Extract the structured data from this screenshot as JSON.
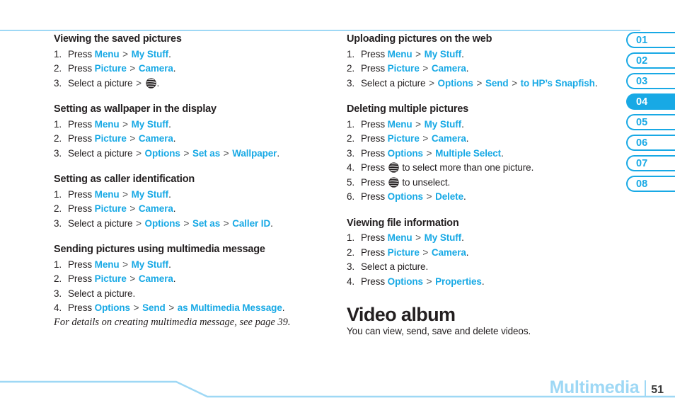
{
  "document": {
    "chapter_label": "Multimedia",
    "page_number": "51"
  },
  "icons": {
    "att_globe": "att-globe-icon"
  },
  "colors": {
    "keyword_blue": "#18a9e5",
    "rule_light_blue": "#9ed8f5",
    "body_text": "#231f20",
    "tab_active_bg": "#18a9e5",
    "tab_active_text": "#ffffff"
  },
  "tabs": [
    {
      "label": "01",
      "active": false
    },
    {
      "label": "02",
      "active": false
    },
    {
      "label": "03",
      "active": false
    },
    {
      "label": "04",
      "active": true
    },
    {
      "label": "05",
      "active": false
    },
    {
      "label": "06",
      "active": false
    },
    {
      "label": "07",
      "active": false
    },
    {
      "label": "08",
      "active": false
    }
  ],
  "left_column": {
    "sections": [
      {
        "title": "Viewing the saved pictures",
        "steps": [
          {
            "num": "1.",
            "parts": [
              {
                "t": "text",
                "v": "Press "
              },
              {
                "t": "kw",
                "v": "Menu"
              },
              {
                "t": "sep",
                "v": " > "
              },
              {
                "t": "kw",
                "v": "My Stuff"
              },
              {
                "t": "text",
                "v": "."
              }
            ]
          },
          {
            "num": "2.",
            "parts": [
              {
                "t": "text",
                "v": "Press "
              },
              {
                "t": "kw",
                "v": "Picture"
              },
              {
                "t": "sep",
                "v": " > "
              },
              {
                "t": "kw",
                "v": "Camera"
              },
              {
                "t": "text",
                "v": "."
              }
            ]
          },
          {
            "num": "3.",
            "parts": [
              {
                "t": "text",
                "v": "Select a picture "
              },
              {
                "t": "sep",
                "v": "> "
              },
              {
                "t": "icon",
                "v": "att-globe"
              },
              {
                "t": "text",
                "v": "."
              }
            ]
          }
        ]
      },
      {
        "title": "Setting as wallpaper in the display",
        "steps": [
          {
            "num": "1.",
            "parts": [
              {
                "t": "text",
                "v": "Press "
              },
              {
                "t": "kw",
                "v": "Menu"
              },
              {
                "t": "sep",
                "v": " > "
              },
              {
                "t": "kw",
                "v": "My Stuff"
              },
              {
                "t": "text",
                "v": "."
              }
            ]
          },
          {
            "num": "2.",
            "parts": [
              {
                "t": "text",
                "v": "Press "
              },
              {
                "t": "kw",
                "v": "Picture"
              },
              {
                "t": "sep",
                "v": " > "
              },
              {
                "t": "kw",
                "v": "Camera"
              },
              {
                "t": "text",
                "v": "."
              }
            ]
          },
          {
            "num": "3.",
            "parts": [
              {
                "t": "text",
                "v": "Select a picture "
              },
              {
                "t": "sep",
                "v": "> "
              },
              {
                "t": "kw",
                "v": "Options"
              },
              {
                "t": "sep",
                "v": " > "
              },
              {
                "t": "kw",
                "v": "Set as"
              },
              {
                "t": "sep",
                "v": " > "
              },
              {
                "t": "kw",
                "v": "Wallpaper"
              },
              {
                "t": "text",
                "v": "."
              }
            ]
          }
        ]
      },
      {
        "title": "Setting as caller identification",
        "steps": [
          {
            "num": "1.",
            "parts": [
              {
                "t": "text",
                "v": "Press "
              },
              {
                "t": "kw",
                "v": "Menu"
              },
              {
                "t": "sep",
                "v": " > "
              },
              {
                "t": "kw",
                "v": "My Stuff"
              },
              {
                "t": "text",
                "v": "."
              }
            ]
          },
          {
            "num": "2.",
            "parts": [
              {
                "t": "text",
                "v": "Press "
              },
              {
                "t": "kw",
                "v": "Picture"
              },
              {
                "t": "sep",
                "v": " > "
              },
              {
                "t": "kw",
                "v": "Camera"
              },
              {
                "t": "text",
                "v": "."
              }
            ]
          },
          {
            "num": "3.",
            "parts": [
              {
                "t": "text",
                "v": "Select a picture "
              },
              {
                "t": "sep",
                "v": "> "
              },
              {
                "t": "kw",
                "v": "Options"
              },
              {
                "t": "sep",
                "v": " > "
              },
              {
                "t": "kw",
                "v": "Set as"
              },
              {
                "t": "sep",
                "v": " > "
              },
              {
                "t": "kw",
                "v": "Caller ID"
              },
              {
                "t": "text",
                "v": "."
              }
            ]
          }
        ]
      },
      {
        "title": "Sending pictures using multimedia message",
        "steps": [
          {
            "num": "1.",
            "parts": [
              {
                "t": "text",
                "v": "Press "
              },
              {
                "t": "kw",
                "v": "Menu"
              },
              {
                "t": "sep",
                "v": " > "
              },
              {
                "t": "kw",
                "v": "My Stuff"
              },
              {
                "t": "text",
                "v": "."
              }
            ]
          },
          {
            "num": "2.",
            "parts": [
              {
                "t": "text",
                "v": "Press "
              },
              {
                "t": "kw",
                "v": "Picture"
              },
              {
                "t": "sep",
                "v": " > "
              },
              {
                "t": "kw",
                "v": "Camera"
              },
              {
                "t": "text",
                "v": "."
              }
            ]
          },
          {
            "num": "3.",
            "parts": [
              {
                "t": "text",
                "v": "Select a picture."
              }
            ]
          },
          {
            "num": "4.",
            "parts": [
              {
                "t": "text",
                "v": "Press "
              },
              {
                "t": "kw",
                "v": "Options"
              },
              {
                "t": "sep",
                "v": " > "
              },
              {
                "t": "kw",
                "v": "Send"
              },
              {
                "t": "sep",
                "v": " > "
              },
              {
                "t": "kw",
                "v": "as Multimedia Message"
              },
              {
                "t": "text",
                "v": "."
              }
            ]
          }
        ],
        "note": "For details on creating multimedia message, see page 39."
      }
    ]
  },
  "right_column": {
    "sections": [
      {
        "title": "Uploading pictures on the web",
        "steps": [
          {
            "num": "1.",
            "parts": [
              {
                "t": "text",
                "v": "Press "
              },
              {
                "t": "kw",
                "v": "Menu"
              },
              {
                "t": "sep",
                "v": " > "
              },
              {
                "t": "kw",
                "v": "My Stuff"
              },
              {
                "t": "text",
                "v": "."
              }
            ]
          },
          {
            "num": "2.",
            "parts": [
              {
                "t": "text",
                "v": "Press "
              },
              {
                "t": "kw",
                "v": "Picture"
              },
              {
                "t": "sep",
                "v": " > "
              },
              {
                "t": "kw",
                "v": "Camera"
              },
              {
                "t": "text",
                "v": "."
              }
            ]
          },
          {
            "num": "3.",
            "parts": [
              {
                "t": "text",
                "v": "Select a picture "
              },
              {
                "t": "sep",
                "v": "> "
              },
              {
                "t": "kw",
                "v": "Options"
              },
              {
                "t": "sep",
                "v": " > "
              },
              {
                "t": "kw",
                "v": "Send"
              },
              {
                "t": "sep",
                "v": " > "
              },
              {
                "t": "kw",
                "v": "to HP’s Snapfish"
              },
              {
                "t": "text",
                "v": "."
              }
            ]
          }
        ]
      },
      {
        "title": "Deleting multiple pictures",
        "steps": [
          {
            "num": "1.",
            "parts": [
              {
                "t": "text",
                "v": "Press "
              },
              {
                "t": "kw",
                "v": "Menu"
              },
              {
                "t": "sep",
                "v": " > "
              },
              {
                "t": "kw",
                "v": "My Stuff"
              },
              {
                "t": "text",
                "v": "."
              }
            ]
          },
          {
            "num": "2.",
            "parts": [
              {
                "t": "text",
                "v": "Press "
              },
              {
                "t": "kw",
                "v": "Picture"
              },
              {
                "t": "sep",
                "v": " > "
              },
              {
                "t": "kw",
                "v": "Camera"
              },
              {
                "t": "text",
                "v": "."
              }
            ]
          },
          {
            "num": "3.",
            "parts": [
              {
                "t": "text",
                "v": "Press "
              },
              {
                "t": "kw",
                "v": "Options"
              },
              {
                "t": "sep",
                "v": " > "
              },
              {
                "t": "kw",
                "v": "Multiple Select"
              },
              {
                "t": "text",
                "v": "."
              }
            ]
          },
          {
            "num": "4.",
            "parts": [
              {
                "t": "text",
                "v": "Press "
              },
              {
                "t": "icon",
                "v": "att-globe"
              },
              {
                "t": "text",
                "v": " to select more than one picture."
              }
            ]
          },
          {
            "num": "5.",
            "parts": [
              {
                "t": "text",
                "v": "Press "
              },
              {
                "t": "icon",
                "v": "att-globe"
              },
              {
                "t": "text",
                "v": " to unselect."
              }
            ]
          },
          {
            "num": "6.",
            "parts": [
              {
                "t": "text",
                "v": "Press "
              },
              {
                "t": "kw",
                "v": "Options"
              },
              {
                "t": "sep",
                "v": " > "
              },
              {
                "t": "kw",
                "v": "Delete"
              },
              {
                "t": "text",
                "v": "."
              }
            ]
          }
        ]
      },
      {
        "title": "Viewing file information",
        "steps": [
          {
            "num": "1.",
            "parts": [
              {
                "t": "text",
                "v": "Press "
              },
              {
                "t": "kw",
                "v": "Menu"
              },
              {
                "t": "sep",
                "v": " > "
              },
              {
                "t": "kw",
                "v": "My Stuff"
              },
              {
                "t": "text",
                "v": "."
              }
            ]
          },
          {
            "num": "2.",
            "parts": [
              {
                "t": "text",
                "v": "Press "
              },
              {
                "t": "kw",
                "v": "Picture"
              },
              {
                "t": "sep",
                "v": " > "
              },
              {
                "t": "kw",
                "v": "Camera"
              },
              {
                "t": "text",
                "v": "."
              }
            ]
          },
          {
            "num": "3.",
            "parts": [
              {
                "t": "text",
                "v": "Select a picture."
              }
            ]
          },
          {
            "num": "4.",
            "parts": [
              {
                "t": "text",
                "v": "Press "
              },
              {
                "t": "kw",
                "v": "Options"
              },
              {
                "t": "sep",
                "v": " > "
              },
              {
                "t": "kw",
                "v": "Properties"
              },
              {
                "t": "text",
                "v": "."
              }
            ]
          }
        ]
      }
    ],
    "feature": {
      "title": "Video album",
      "description": "You can view, send, save and delete videos."
    }
  }
}
